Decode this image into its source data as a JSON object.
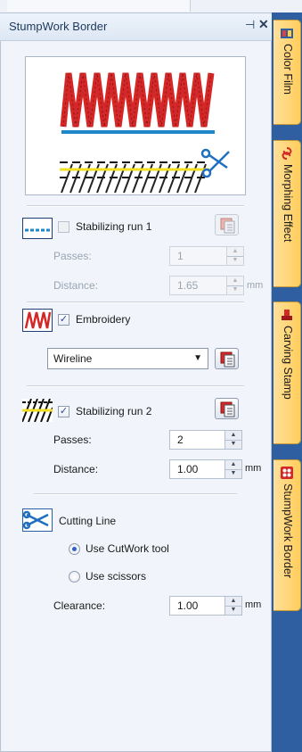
{
  "panel": {
    "title": "StumpWork Border",
    "pin_glyph": "⊣",
    "close_glyph": "✕"
  },
  "stabilizing_run_1": {
    "label": "Stabilizing run 1",
    "checked": false,
    "enabled": false,
    "passes_label": "Passes:",
    "passes_value": "1",
    "distance_label": "Distance:",
    "distance_value": "1.65",
    "distance_unit": "mm"
  },
  "embroidery": {
    "label": "Embroidery",
    "checked": true,
    "type_value": "Wireline"
  },
  "stabilizing_run_2": {
    "label": "Stabilizing run 2",
    "checked": true,
    "enabled": true,
    "passes_label": "Passes:",
    "passes_value": "2",
    "distance_label": "Distance:",
    "distance_value": "1.00",
    "distance_unit": "mm"
  },
  "cutting_line": {
    "label": "Cutting Line",
    "option_cutwork": "Use CutWork tool",
    "option_scissors": "Use scissors",
    "selected": "Use CutWork tool",
    "clearance_label": "Clearance:",
    "clearance_value": "1.00",
    "clearance_unit": "mm"
  },
  "side_tabs": [
    {
      "label": "Color Film",
      "icon": "color-film-icon"
    },
    {
      "label": "Morphing Effect",
      "icon": "morphing-effect-icon"
    },
    {
      "label": "Carving Stamp",
      "icon": "carving-stamp-icon"
    },
    {
      "label": "StumpWork Border",
      "icon": "stumpwork-border-icon"
    }
  ],
  "colors": {
    "accent_blue": "#2f5fa1",
    "tab_orange": "#ffcd5c",
    "stitch_red": "#d42828"
  }
}
